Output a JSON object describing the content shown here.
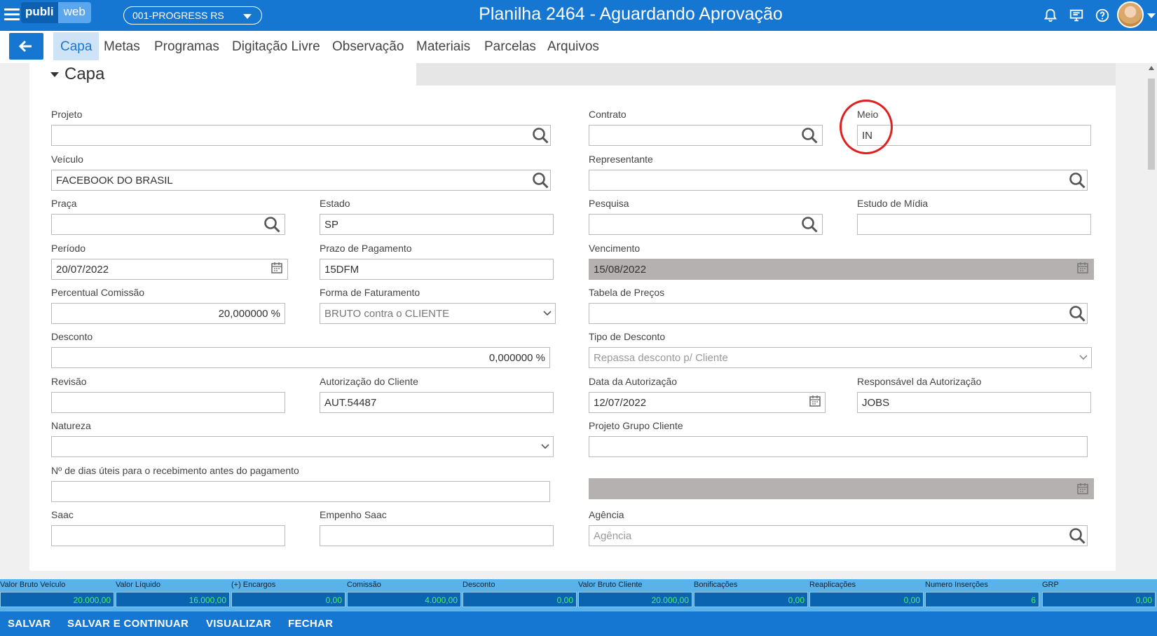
{
  "header": {
    "logo_left": "publi",
    "logo_right": "web",
    "company": "001-PROGRESS RS",
    "title": "Planilha 2464 - Aguardando Aprovação"
  },
  "tabs": [
    "Capa",
    "Metas",
    "Programas",
    "Digitação Livre",
    "Observação",
    "Materiais",
    "Parcelas",
    "Arquivos"
  ],
  "section": {
    "title": "Capa"
  },
  "form": {
    "projeto": {
      "label": "Projeto",
      "value": ""
    },
    "contrato": {
      "label": "Contrato",
      "value": ""
    },
    "meio": {
      "label": "Meio",
      "value": "IN"
    },
    "veiculo": {
      "label": "Veículo",
      "value": "FACEBOOK DO BRASIL"
    },
    "representante": {
      "label": "Representante",
      "value": ""
    },
    "praca": {
      "label": "Praça",
      "value": ""
    },
    "estado": {
      "label": "Estado",
      "value": "SP"
    },
    "pesquisa": {
      "label": "Pesquisa",
      "value": ""
    },
    "estudo_midia": {
      "label": "Estudo de Mídia",
      "value": ""
    },
    "periodo": {
      "label": "Período",
      "value": "20/07/2022"
    },
    "prazo_pagamento": {
      "label": "Prazo de Pagamento",
      "value": "15DFM"
    },
    "vencimento": {
      "label": "Vencimento",
      "value": "15/08/2022"
    },
    "percentual_comissao": {
      "label": "Percentual Comissão",
      "value": "20,000000 %"
    },
    "forma_faturamento": {
      "label": "Forma de Faturamento",
      "value": "BRUTO contra o CLIENTE"
    },
    "tabela_precos": {
      "label": "Tabela de Preços",
      "value": ""
    },
    "desconto": {
      "label": "Desconto",
      "value": "0,000000 %"
    },
    "tipo_desconto": {
      "label": "Tipo de Desconto",
      "value": "Repassa desconto p/ Cliente"
    },
    "revisao": {
      "label": "Revisão",
      "value": ""
    },
    "autorizacao_cliente": {
      "label": "Autorização do Cliente",
      "value": "AUT.54487"
    },
    "data_autorizacao": {
      "label": "Data da Autorização",
      "value": "12/07/2022"
    },
    "responsavel_autorizacao": {
      "label": "Responsável da Autorização",
      "value": "JOBS"
    },
    "natureza": {
      "label": "Natureza",
      "value": ""
    },
    "projeto_grupo_cliente": {
      "label": "Projeto Grupo Cliente",
      "value": ""
    },
    "dias_uteis": {
      "label": "Nº de dias úteis para o recebimento antes do pagamento",
      "value": ""
    },
    "data_extra": {
      "value": ""
    },
    "saac": {
      "label": "Saac",
      "value": ""
    },
    "empenho_saac": {
      "label": "Empenho Saac",
      "value": ""
    },
    "agencia": {
      "label": "Agência",
      "placeholder": "Agência"
    }
  },
  "totals": [
    {
      "label": "Valor Bruto Veículo",
      "value": "20.000,00"
    },
    {
      "label": "Valor Líquido",
      "value": "16.000,00"
    },
    {
      "label": "(+) Encargos",
      "value": "0,00"
    },
    {
      "label": "Comissão",
      "value": "4.000,00"
    },
    {
      "label": "Desconto",
      "value": "0,00"
    },
    {
      "label": "Valor Bruto Cliente",
      "value": "20.000,00"
    },
    {
      "label": "Bonificações",
      "value": "0,00"
    },
    {
      "label": "Reaplicações",
      "value": "0,00"
    },
    {
      "label": "Numero Inserções",
      "value": "6"
    },
    {
      "label": "GRP",
      "value": "0,00"
    }
  ],
  "footer": [
    "SALVAR",
    "SALVAR E CONTINUAR",
    "VISUALIZAR",
    "FECHAR"
  ],
  "colors": {
    "primary": "#1677d2",
    "totals_bg": "#5ab2ea",
    "totals_value": "#4ef06a",
    "highlight": "#e02020"
  }
}
